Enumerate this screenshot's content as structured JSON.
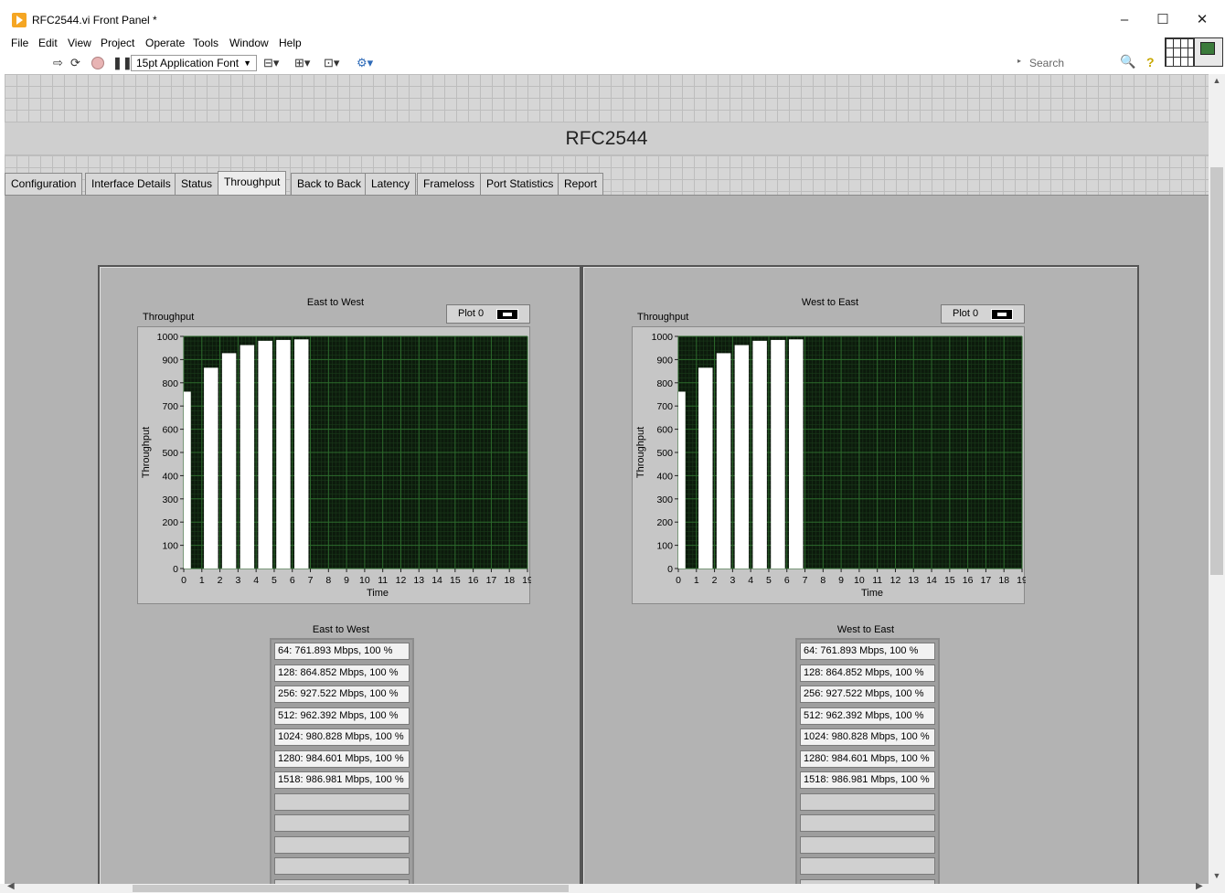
{
  "window": {
    "title": "RFC2544.vi Front Panel *",
    "minimize": "–",
    "maximize": "☐",
    "close": "✕"
  },
  "menu": [
    "File",
    "Edit",
    "View",
    "Project",
    "Operate",
    "Tools",
    "Window",
    "Help"
  ],
  "toolbar": {
    "font": "15pt Application Font",
    "search_placeholder": "Search",
    "icons": [
      "run-arrow-icon",
      "run-continuously-icon",
      "abort-icon",
      "pause-icon",
      "align-objects-icon",
      "distribute-objects-icon",
      "resize-objects-icon",
      "reorder-icon",
      "cleanup-diagram-icon",
      "search-icon",
      "help-icon"
    ]
  },
  "panel": {
    "title": "RFC2544",
    "tabs": [
      "Configuration",
      "Interface Details",
      "Status",
      "Throughput",
      "Back to Back",
      "Latency",
      "Frameloss",
      "Port Statistics",
      "Report"
    ],
    "active_tab": "Throughput"
  },
  "charts": {
    "left": {
      "title": "East to West",
      "legend": "Plot 0",
      "ylabel": "Throughput",
      "yaxis_title": "Throughput",
      "xlabel": "Time"
    },
    "right": {
      "title": "West to East",
      "legend": "Plot 0",
      "ylabel": "Throughput",
      "yaxis_title": "Throughput",
      "xlabel": "Time"
    }
  },
  "chart_data": [
    {
      "type": "bar",
      "title": "East to West",
      "xlabel": "Time",
      "ylabel": "Throughput",
      "series": [
        {
          "name": "Plot 0",
          "x": [
            0,
            1,
            2,
            3,
            4,
            5,
            6
          ],
          "values": [
            761.893,
            864.852,
            927.522,
            962.392,
            980.828,
            984.601,
            986.981
          ]
        }
      ],
      "xlim": [
        0,
        19
      ],
      "ylim": [
        0,
        1000
      ],
      "x_ticks": [
        "0",
        "1",
        "2",
        "3",
        "4",
        "5",
        "6",
        "7",
        "8",
        "9",
        "10",
        "11",
        "12",
        "13",
        "14",
        "15",
        "16",
        "17",
        "18",
        "19"
      ],
      "y_ticks": [
        "0",
        "100",
        "200",
        "300",
        "400",
        "500",
        "600",
        "700",
        "800",
        "900",
        "1000"
      ],
      "grid": true
    },
    {
      "type": "bar",
      "title": "West to East",
      "xlabel": "Time",
      "ylabel": "Throughput",
      "series": [
        {
          "name": "Plot 0",
          "x": [
            0,
            1,
            2,
            3,
            4,
            5,
            6
          ],
          "values": [
            761.893,
            864.852,
            927.522,
            962.392,
            980.828,
            984.601,
            986.981
          ]
        }
      ],
      "xlim": [
        0,
        19
      ],
      "ylim": [
        0,
        1000
      ],
      "x_ticks": [
        "0",
        "1",
        "2",
        "3",
        "4",
        "5",
        "6",
        "7",
        "8",
        "9",
        "10",
        "11",
        "12",
        "13",
        "14",
        "15",
        "16",
        "17",
        "18",
        "19"
      ],
      "y_ticks": [
        "0",
        "100",
        "200",
        "300",
        "400",
        "500",
        "600",
        "700",
        "800",
        "900",
        "1000"
      ],
      "grid": true
    }
  ],
  "results": {
    "left": {
      "title": "East to West",
      "rows": [
        "64: 761.893 Mbps, 100 %",
        "128: 864.852 Mbps, 100 %",
        "256: 927.522 Mbps, 100 %",
        "512: 962.392 Mbps, 100 %",
        "1024: 980.828 Mbps, 100 %",
        "1280: 984.601 Mbps, 100 %",
        "1518: 986.981 Mbps, 100 %",
        "",
        "",
        "",
        "",
        ""
      ]
    },
    "right": {
      "title": "West to East",
      "rows": [
        "64: 761.893 Mbps, 100 %",
        "128: 864.852 Mbps, 100 %",
        "256: 927.522 Mbps, 100 %",
        "512: 962.392 Mbps, 100 %",
        "1024: 980.828 Mbps, 100 %",
        "1280: 984.601 Mbps, 100 %",
        "1518: 986.981 Mbps, 100 %",
        "",
        "",
        "",
        "",
        ""
      ]
    }
  },
  "colors": {
    "plot_bg": "#0c1a0c",
    "grid_major": "#2d6b2d",
    "grid_minor": "#1a3a1a",
    "bar": "#ffffff",
    "panel_bg": "#b3b3b3"
  }
}
